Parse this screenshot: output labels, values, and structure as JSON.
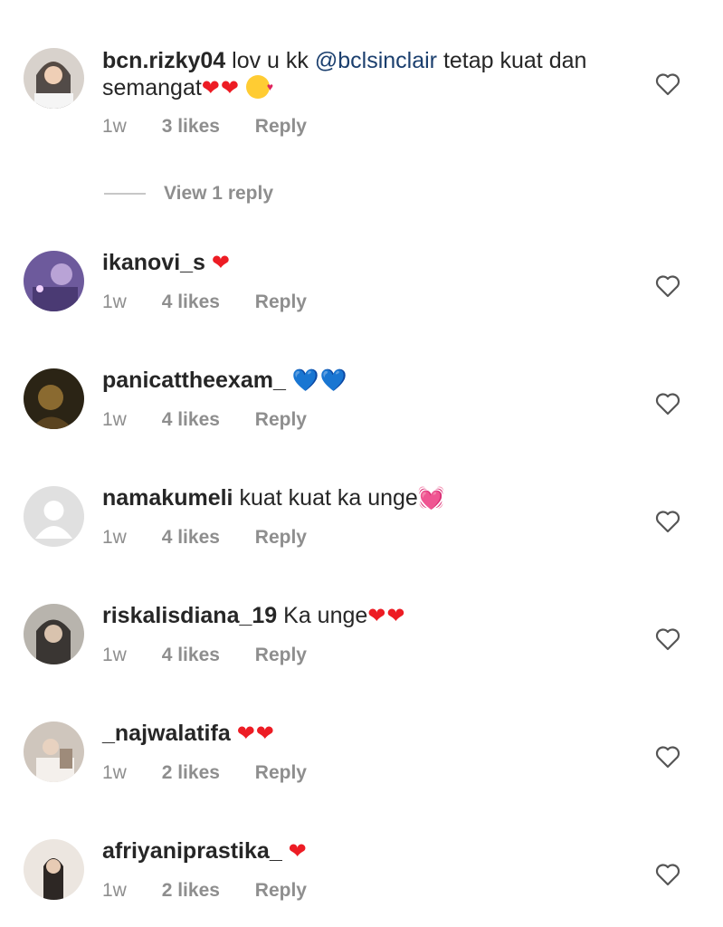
{
  "comments": [
    {
      "username": "bcn.rizky04",
      "text": "lov u kk",
      "mention": "@bclsinclair",
      "text2": "tetap kuat dan semangat",
      "emoji": "❤❤",
      "time": "1w",
      "likes": "3 likes",
      "reply": "Reply"
    },
    {
      "username": "ikanovi_s",
      "text": "",
      "emoji": "❤",
      "time": "1w",
      "likes": "4 likes",
      "reply": "Reply"
    },
    {
      "username": "panicattheexam_",
      "text": "",
      "emoji": "💙💙",
      "time": "1w",
      "likes": "4 likes",
      "reply": "Reply"
    },
    {
      "username": "namakumeli",
      "text": "kuat kuat ka unge",
      "emoji": "💓",
      "time": "1w",
      "likes": "4 likes",
      "reply": "Reply"
    },
    {
      "username": "riskalisdiana_19",
      "text": "Ka unge",
      "emoji": "❤❤",
      "time": "1w",
      "likes": "4 likes",
      "reply": "Reply"
    },
    {
      "username": "_najwalatifa",
      "text": "",
      "emoji": "❤❤",
      "time": "1w",
      "likes": "2 likes",
      "reply": "Reply"
    },
    {
      "username": "afriyaniprastika_",
      "text": "",
      "emoji": "❤",
      "time": "1w",
      "likes": "2 likes",
      "reply": "Reply"
    }
  ],
  "view_replies_label": "View 1 reply",
  "colors": {
    "mention": "#1b3f6e",
    "meta": "#8e8e8e",
    "heart": "#ed1c24"
  }
}
